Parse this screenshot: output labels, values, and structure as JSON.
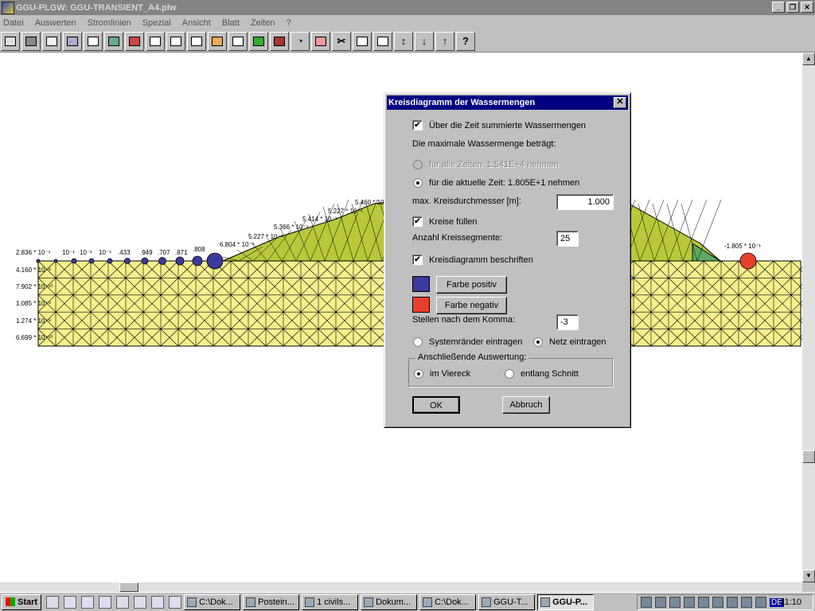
{
  "window": {
    "title": "GGU-PLGW: GGU-TRANSIENT_A4.plw",
    "minimize": "_",
    "maximize": "❐",
    "close": "✕"
  },
  "menu": [
    "Datei",
    "Auswerten",
    "Stromlinien",
    "Spezial",
    "Ansicht",
    "Blatt",
    "Zeiten",
    "?"
  ],
  "toolbar_icons": [
    "open-icon",
    "save-icon",
    "print-icon",
    "tool-icon",
    "zoom-icon",
    "layer-icon",
    "color-icon",
    "page-icon",
    "polygon-icon",
    "shape-icon",
    "fill-icon",
    "line-icon",
    "map-icon",
    "map2-icon",
    "clock-icon",
    "rect-icon",
    "scissors-icon",
    "grid-icon",
    "gate-icon",
    "vertical-arrows-icon",
    "down-arrow-icon",
    "up-arrow-icon",
    "help-icon"
  ],
  "drawing": {
    "left_labels": [
      "2.836 * 10⁻¹",
      "4.160 * 10⁻⁸",
      "7.902 * 10⁻¹⁰",
      "1.085 * 10⁻⁹",
      "1.274 * 10⁻⁹",
      "6.699 * 10⁻¹⁰"
    ],
    "top_labels": [
      "10⁻¹",
      "10⁻¹",
      "10⁻¹",
      ".433",
      ".949",
      ".707",
      ".871",
      ".808",
      "6.804 * 10⁻¹",
      "5.227 * 10⁻¹",
      "5.366 * 10⁻¹",
      "5.414 * 10⁻¹",
      "5.227 * 10⁻¹",
      "5.460 * 10⁻¹"
    ],
    "right_label": "-1.805 * 10⁻¹",
    "colors": {
      "soil": "#f5ef8c",
      "embankment": "#b8c83a",
      "toe": "#5aaa60",
      "positive": "#3c3a9c",
      "negative": "#e8402c"
    }
  },
  "dialog": {
    "title": "Kreisdiagramm der Wassermengen",
    "close": "✕",
    "summed_label": "Über die Zeit summierte Wassermengen",
    "summed_checked": true,
    "max_label": "Die maximale Wassermenge beträgt:",
    "all_times_label": "für alle Zeiten:  1.541E+4 nehmen",
    "current_time_label": "für die aktuelle Zeit:  1.805E+1 nehmen",
    "diameter_label": "max. Kreisdurchmesser [m]:",
    "diameter_value": "1.000",
    "fill_label": "Kreise füllen",
    "fill_checked": true,
    "segments_label": "Anzahl Kreissegmente:",
    "segments_value": "25",
    "annotate_label": "Kreisdiagramm beschriften",
    "annotate_checked": true,
    "color_positive_label": "Farbe positiv",
    "color_negative_label": "Farbe negativ",
    "decimals_label": "Stellen nach dem Komma:",
    "decimals_value": "-3",
    "system_edges_label": "Systemränder eintragen",
    "net_label": "Netz eintragen",
    "evaluation_group_label": "Anschließende Auswertung:",
    "square_label": "im Viereck",
    "along_cut_label": "entlang Schnitt",
    "ok_label": "OK",
    "cancel_label": "Abbruch"
  },
  "taskbar": {
    "start_label": "Start",
    "tasks": [
      "C:\\Dok...",
      "Postein...",
      "1 civils...",
      "Dokum...",
      "C:\\Dok...",
      "GGU-T...",
      "GGU-P..."
    ],
    "active_task": "GGU-P...",
    "language": "DE",
    "clock": "11:10"
  }
}
